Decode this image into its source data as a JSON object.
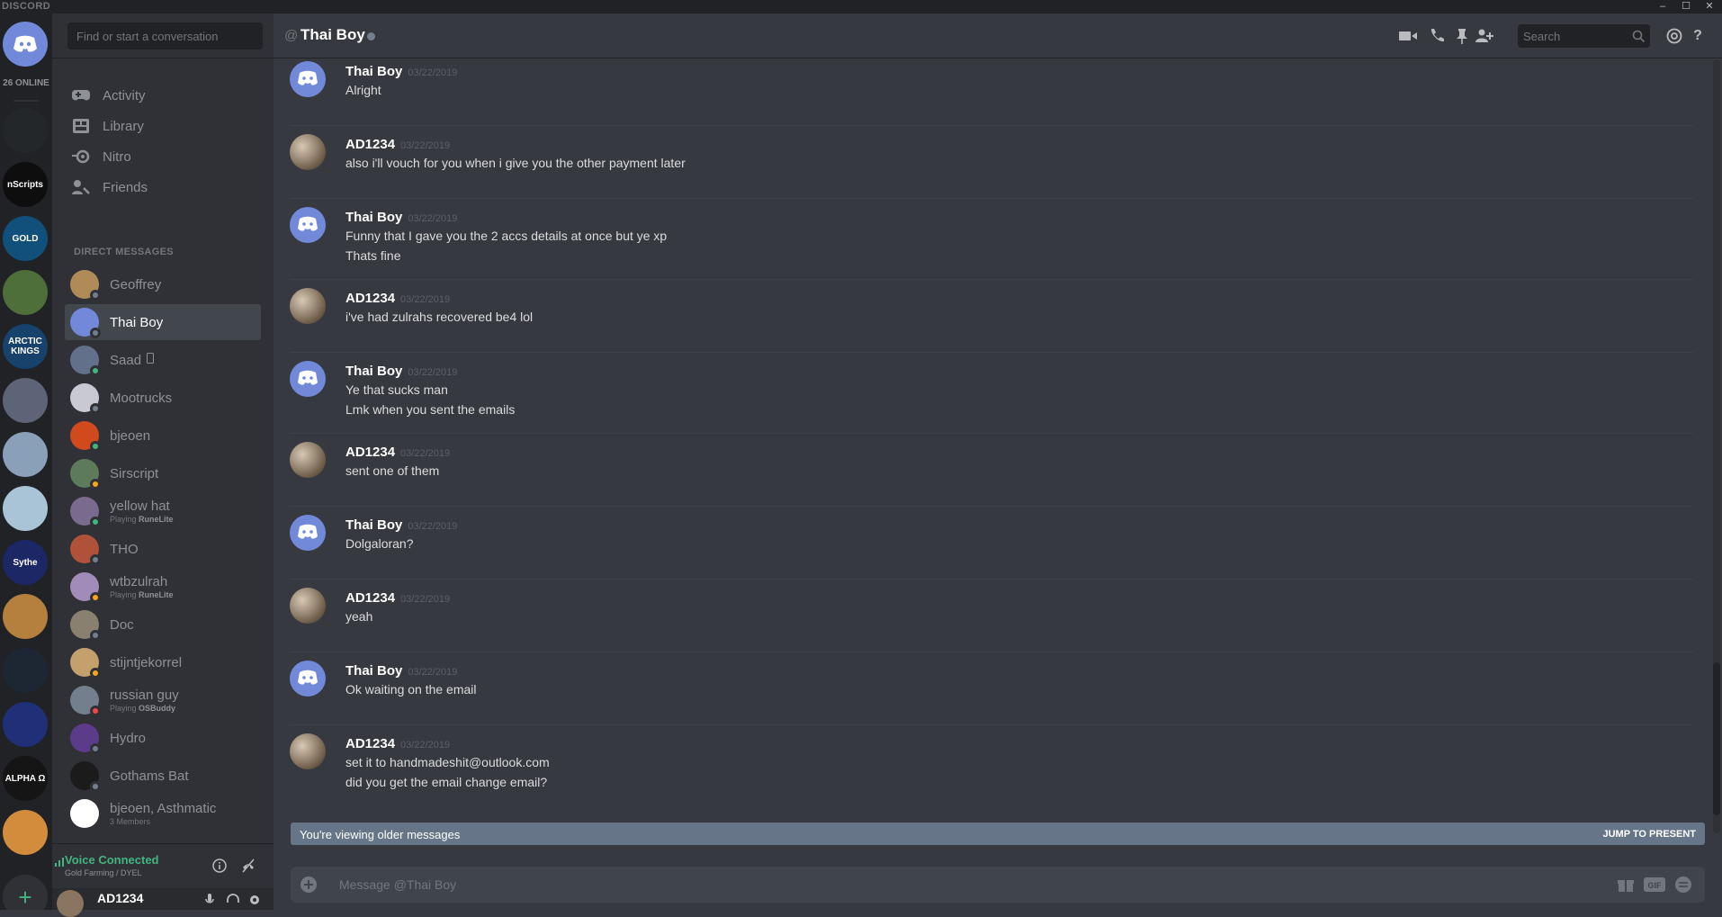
{
  "app": {
    "brand": "DISCORD",
    "window_controls": [
      "–",
      "☐",
      "✕"
    ]
  },
  "guilds": {
    "online_count": "26 ONLINE",
    "items": [
      {
        "label": "",
        "color": "#23272a"
      },
      {
        "label": "nScripts",
        "color": "#0e0e0e"
      },
      {
        "label": "GOLD",
        "color": "#11507a"
      },
      {
        "label": "",
        "color": "#4f6f3a"
      },
      {
        "label": "ARCTIC KINGS",
        "color": "#16426b"
      },
      {
        "label": "",
        "color": "#5d6477"
      },
      {
        "label": "",
        "color": "#8aa0b8"
      },
      {
        "label": "",
        "color": "#a9c4d6"
      },
      {
        "label": "Sythe",
        "color": "#1c2766"
      },
      {
        "label": "",
        "color": "#b5803d"
      },
      {
        "label": "",
        "color": "#1d2733"
      },
      {
        "label": "",
        "color": "#1f2f78"
      },
      {
        "label": "ALPHA Ω",
        "color": "#151515"
      },
      {
        "label": "",
        "color": "#d38c3c"
      }
    ]
  },
  "sidebar": {
    "search_placeholder": "Find or start a conversation",
    "nav": [
      {
        "label": "Activity",
        "icon": "gamepad-icon"
      },
      {
        "label": "Library",
        "icon": "library-icon"
      },
      {
        "label": "Nitro",
        "icon": "nitro-icon"
      },
      {
        "label": "Friends",
        "icon": "friends-icon"
      }
    ],
    "dm_header": "DIRECT MESSAGES",
    "dms": [
      {
        "name": "Geoffrey",
        "status": "#747f8d",
        "avatar": "#b08b57"
      },
      {
        "name": "Thai Boy",
        "status": "#747f8d",
        "avatar": "#7289da",
        "active": true
      },
      {
        "name": "Saad",
        "status": "#43b581",
        "avatar": "#62708a",
        "mobile": true
      },
      {
        "name": "Mootrucks",
        "status": "#747f8d",
        "avatar": "#c9c9d4"
      },
      {
        "name": "bjeoen",
        "status": "#43b581",
        "avatar": "#d04a1d"
      },
      {
        "name": "Sirscript",
        "status": "#faa61a",
        "avatar": "#5d7a5a"
      },
      {
        "name": "yellow hat",
        "status": "#43b581",
        "avatar": "#7a6a8e",
        "sub_prefix": "Playing ",
        "sub_game": "RuneLite"
      },
      {
        "name": "THO",
        "status": "#747f8d",
        "avatar": "#b0523a"
      },
      {
        "name": "wtbzulrah",
        "status": "#faa61a",
        "avatar": "#a18bb8",
        "sub_prefix": "Playing ",
        "sub_game": "RuneLite"
      },
      {
        "name": "Doc",
        "status": "#747f8d",
        "avatar": "#8a8070"
      },
      {
        "name": "stijntjekorrel",
        "status": "#faa61a",
        "avatar": "#c4a06c"
      },
      {
        "name": "russian guy",
        "status": "#f04747",
        "avatar": "#747f8d",
        "sub_prefix": "Playing ",
        "sub_game": "OSBuddy"
      },
      {
        "name": "Hydro",
        "status": "#747f8d",
        "avatar": "#5a3c8a"
      },
      {
        "name": "Gothams Bat",
        "status": "#747f8d",
        "avatar": "#1b1b1b"
      },
      {
        "name": "bjeoen, Asthmatic",
        "status": "",
        "avatar": "#ffffff",
        "sub_prefix": "3 Members",
        "sub_game": ""
      }
    ],
    "voice": {
      "label": "Voice Connected",
      "sub": "Gold Farming / DYEL"
    },
    "user": {
      "name": "AD1234"
    }
  },
  "header": {
    "title": "Thai Boy",
    "search_placeholder": "Search"
  },
  "messages": [
    {
      "author": "Thai Boy",
      "time": "03/22/2019",
      "lines": [
        "Alright"
      ],
      "kind": "discord"
    },
    {
      "author": "AD1234",
      "time": "03/22/2019",
      "lines": [
        "also i'll vouch for you when i give you the other payment later"
      ],
      "kind": "user"
    },
    {
      "author": "Thai Boy",
      "time": "03/22/2019",
      "lines": [
        "Funny that I gave you the 2 accs details at once but ye xp",
        "Thats fine"
      ],
      "kind": "discord"
    },
    {
      "author": "AD1234",
      "time": "03/22/2019",
      "lines": [
        "i've had zulrahs recovered be4 lol"
      ],
      "kind": "user"
    },
    {
      "author": "Thai Boy",
      "time": "03/22/2019",
      "lines": [
        "Ye that sucks man",
        "Lmk when you sent the emails"
      ],
      "kind": "discord"
    },
    {
      "author": "AD1234",
      "time": "03/22/2019",
      "lines": [
        "sent one  of them"
      ],
      "kind": "user"
    },
    {
      "author": "Thai Boy",
      "time": "03/22/2019",
      "lines": [
        "Dolgaloran?"
      ],
      "kind": "discord"
    },
    {
      "author": "AD1234",
      "time": "03/22/2019",
      "lines": [
        "yeah"
      ],
      "kind": "user"
    },
    {
      "author": "Thai Boy",
      "time": "03/22/2019",
      "lines": [
        "Ok waiting on the email"
      ],
      "kind": "discord"
    },
    {
      "author": "AD1234",
      "time": "03/22/2019",
      "lines": [
        "set it to handmadeshit@outlook.com",
        "did you get the email change email?"
      ],
      "kind": "user"
    }
  ],
  "older_bar": {
    "text": "You're viewing older messages",
    "jump": "JUMP TO PRESENT"
  },
  "composer": {
    "placeholder": "Message @Thai Boy"
  },
  "colors": {
    "blurple": "#7289da",
    "online": "#43b581",
    "idle": "#faa61a",
    "dnd": "#f04747",
    "offline": "#747f8d"
  }
}
